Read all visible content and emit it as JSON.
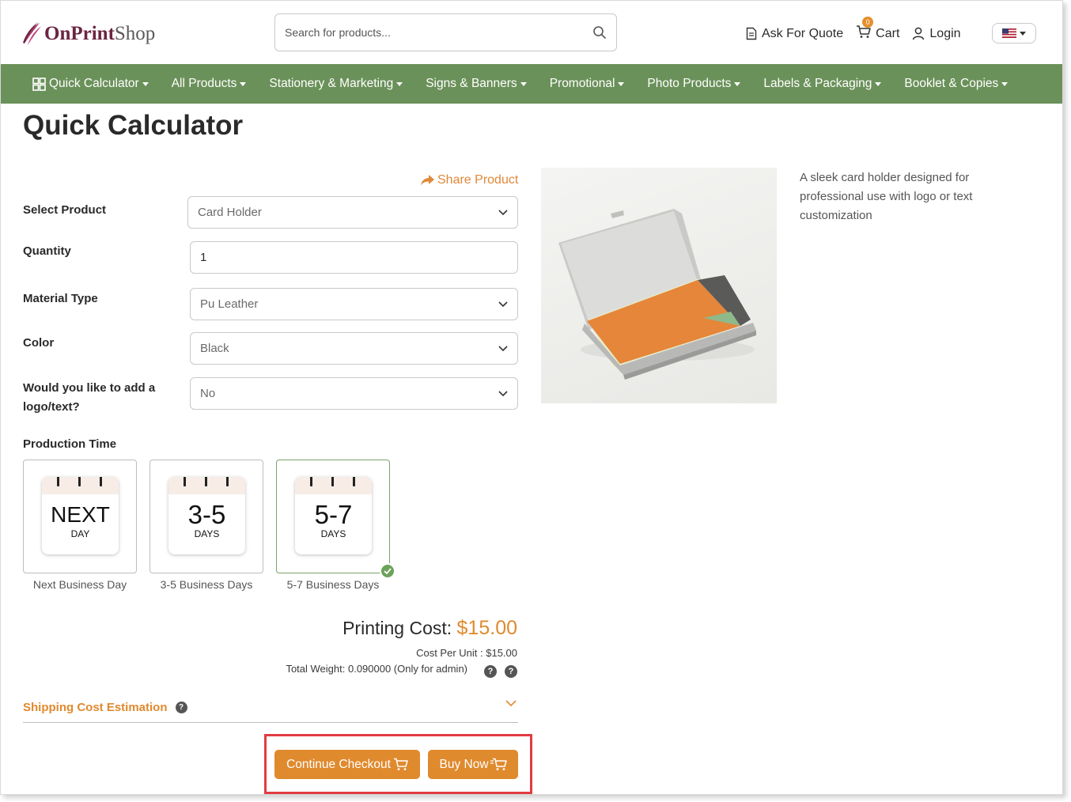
{
  "header": {
    "logo_bold": "OnPrint",
    "logo_light": "Shop",
    "search_placeholder": "Search for products...",
    "ask_quote": "Ask For Quote",
    "cart": "Cart",
    "cart_count": "0",
    "login": "Login"
  },
  "nav": {
    "items": [
      "Quick Calculator",
      "All Products",
      "Stationery & Marketing",
      "Signs & Banners",
      "Promotional",
      "Photo Products",
      "Labels & Packaging",
      "Booklet & Copies"
    ]
  },
  "page": {
    "title": "Quick Calculator",
    "share": "Share Product"
  },
  "form": {
    "product_label": "Select Product",
    "product_value": "Card Holder",
    "quantity_label": "Quantity",
    "quantity_value": "1",
    "material_label": "Material Type",
    "material_value": "Pu Leather",
    "color_label": "Color",
    "color_value": "Black",
    "logo_label": "Would you like to add a logo/text?",
    "logo_value": "No",
    "production_label": "Production Time"
  },
  "production": [
    {
      "big": "NEXT",
      "small": "DAY",
      "caption": "Next Business Day",
      "selected": false
    },
    {
      "big": "3-5",
      "small": "DAYS",
      "caption": "3-5 Business Days",
      "selected": false
    },
    {
      "big": "5-7",
      "small": "DAYS",
      "caption": "5-7 Business Days",
      "selected": true
    }
  ],
  "pricing": {
    "printing_cost_label": "Printing Cost:",
    "printing_cost": "$15.00",
    "cost_per_unit": "Cost Per Unit : $15.00",
    "total_weight": "Total Weight: 0.090000 (Only for admin)"
  },
  "shipping": {
    "label": "Shipping Cost Estimation"
  },
  "actions": {
    "continue": "Continue Checkout",
    "buy_now": "Buy Now"
  },
  "product": {
    "description": "A sleek card holder designed for professional use with logo or text customization"
  },
  "colors": {
    "nav_green": "#6b915a",
    "accent_orange": "#e08a2e",
    "highlight_red": "#e23b42"
  }
}
